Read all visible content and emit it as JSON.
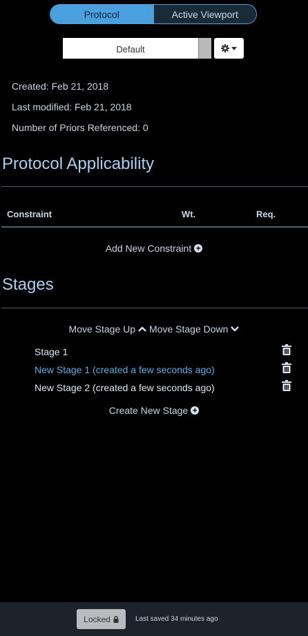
{
  "tabs": [
    {
      "label": "Protocol",
      "active": true
    },
    {
      "label": "Active Viewport",
      "active": false
    }
  ],
  "protocol_select": {
    "value": "Default"
  },
  "icons": {
    "gear": "gear-icon",
    "caret": "caret-down-icon",
    "plus": "plus-circle-icon",
    "trash": "trash-icon",
    "lock": "lock-icon"
  },
  "meta": {
    "created": "Created: Feb 21, 2018",
    "modified": "Last modified: Feb 21, 2018",
    "priors": "Number of Priors Referenced: 0"
  },
  "applicability": {
    "title": "Protocol Applicability",
    "columns": [
      "Constraint",
      "Wt.",
      "Req."
    ],
    "add_label": "Add New Constraint"
  },
  "stages": {
    "title": "Stages",
    "move_up": "Move Stage Up",
    "move_down": "Move Stage Down",
    "items": [
      {
        "label": "Stage 1",
        "selected": false
      },
      {
        "label": "New Stage 1 (created a few seconds ago)",
        "selected": true
      },
      {
        "label": "New Stage 2 (created a few seconds ago)",
        "selected": false
      }
    ],
    "create_label": "Create New Stage"
  },
  "footer": {
    "locked_label": "Locked",
    "saved_text": "Last saved 34 minutes ago"
  },
  "colors": {
    "background": "#000000",
    "accent": "#4aa0df",
    "title": "#a8d0f2",
    "selected_stage": "#5aaee6",
    "footer": "#1d232a"
  }
}
